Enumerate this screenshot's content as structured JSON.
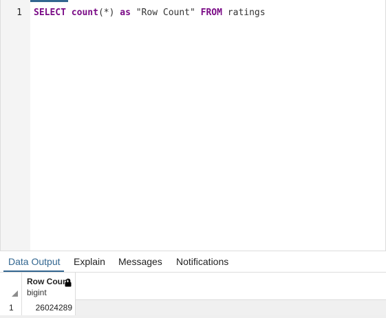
{
  "editor": {
    "line_number": "1",
    "query": {
      "select": "SELECT",
      "func": "count",
      "args": "(*)",
      "as": "as",
      "alias": "\"Row Count\"",
      "from": "FROM",
      "table": "ratings"
    }
  },
  "results": {
    "tabs": [
      {
        "label": "Data Output",
        "active": true
      },
      {
        "label": "Explain",
        "active": false
      },
      {
        "label": "Messages",
        "active": false
      },
      {
        "label": "Notifications",
        "active": false
      }
    ],
    "columns": [
      {
        "name": "Row Count",
        "type": "bigint",
        "icon": "lock-icon"
      }
    ],
    "rows": [
      {
        "row_number": "1",
        "cells": [
          "26024289"
        ]
      }
    ]
  },
  "colors": {
    "accent": "#326690",
    "keyword": "#7a0b86"
  }
}
